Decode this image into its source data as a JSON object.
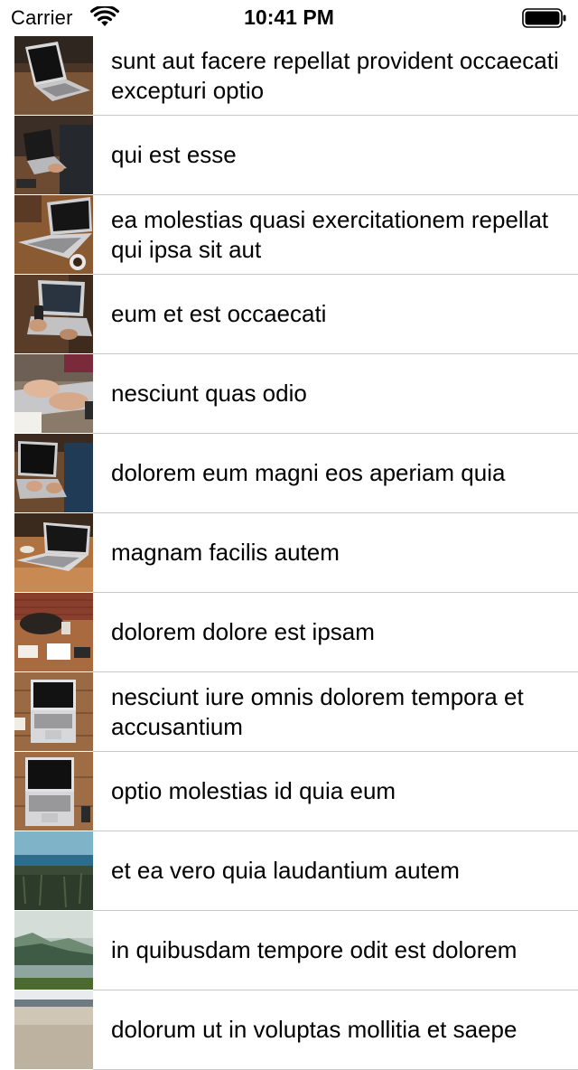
{
  "status_bar": {
    "carrier": "Carrier",
    "time": "10:41 PM"
  },
  "rows": [
    {
      "title": "sunt aut facere repellat provident occaecati excepturi optio",
      "thumb": "laptop-on-wood-thumbnail"
    },
    {
      "title": "qui est esse",
      "thumb": "person-typing-laptop-thumbnail"
    },
    {
      "title": "ea molestias quasi exercitationem repellat qui ipsa sit aut",
      "thumb": "laptop-with-coffee-thumbnail"
    },
    {
      "title": "eum et est occaecati",
      "thumb": "hands-phone-laptop-thumbnail"
    },
    {
      "title": "nesciunt quas odio",
      "thumb": "hands-keyboard-thumbnail"
    },
    {
      "title": "dolorem eum magni eos aperiam quia",
      "thumb": "person-laptop-desk-thumbnail"
    },
    {
      "title": "magnam facilis autem",
      "thumb": "laptop-on-table-thumbnail"
    },
    {
      "title": "dolorem dolore est ipsam",
      "thumb": "desk-brick-wall-thumbnail"
    },
    {
      "title": "nesciunt iure omnis dolorem tempora et accusantium",
      "thumb": "laptop-topdown-thumbnail"
    },
    {
      "title": "optio molestias id quia eum",
      "thumb": "laptop-topdown-2-thumbnail"
    },
    {
      "title": "et ea vero quia laudantium autem",
      "thumb": "sea-landscape-thumbnail"
    },
    {
      "title": "in quibusdam tempore odit est dolorem",
      "thumb": "misty-lake-thumbnail"
    },
    {
      "title": "dolorum ut in voluptas mollitia et saepe",
      "thumb": "beach-thumbnail"
    }
  ]
}
